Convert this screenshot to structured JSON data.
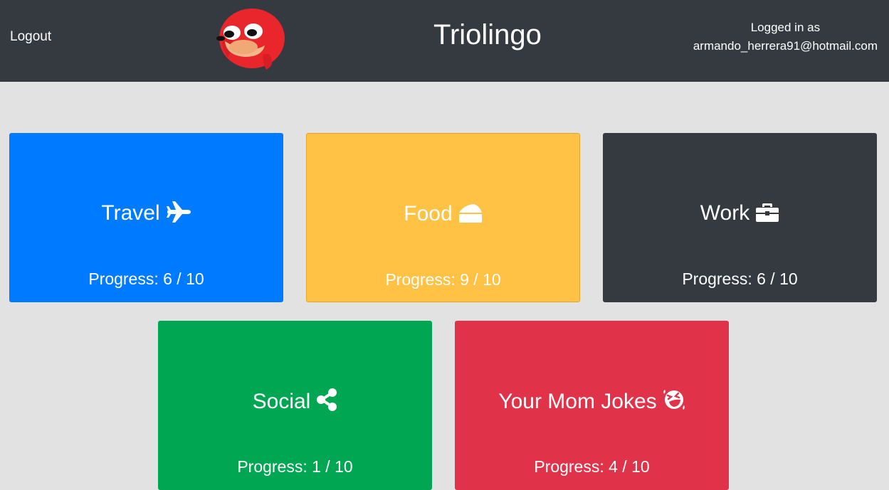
{
  "header": {
    "logout_label": "Logout",
    "brand": "Triolingo",
    "logged_in_label": "Logged in as",
    "user_email": "armando_herrera91@hotmail.com",
    "logo_icon": "knuckles-mascot-icon"
  },
  "colors": {
    "navbar": "#343a40",
    "background": "#e2e2e2",
    "travel": "#007bff",
    "food": "#ffc244",
    "work": "#343a40",
    "social": "#00a651",
    "jokes": "#e0334a"
  },
  "categories": [
    {
      "title": "Travel",
      "icon": "plane-icon",
      "progress_label": "Progress: 6 / 10",
      "progress": {
        "done": 6,
        "total": 10
      }
    },
    {
      "title": "Food",
      "icon": "cheese-icon",
      "progress_label": "Progress: 9 / 10",
      "progress": {
        "done": 9,
        "total": 10
      }
    },
    {
      "title": "Work",
      "icon": "briefcase-icon",
      "progress_label": "Progress: 6 / 10",
      "progress": {
        "done": 6,
        "total": 10
      }
    },
    {
      "title": "Social",
      "icon": "share-icon",
      "progress_label": "Progress: 1 / 10",
      "progress": {
        "done": 1,
        "total": 10
      }
    },
    {
      "title": "Your Mom Jokes",
      "icon": "laugh-squint-icon",
      "progress_label": "Progress: 4 / 10",
      "progress": {
        "done": 4,
        "total": 10
      }
    }
  ]
}
